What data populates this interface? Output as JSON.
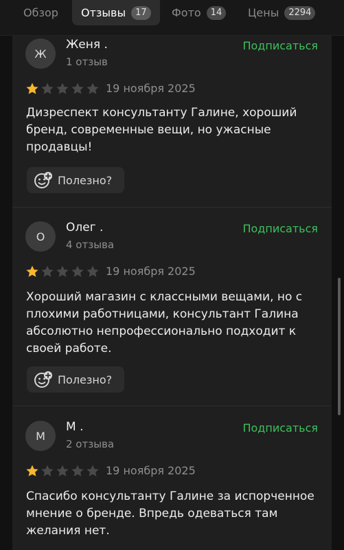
{
  "tabs": [
    {
      "label": "Обзор",
      "count": null
    },
    {
      "label": "Отзывы",
      "count": "17",
      "active": true
    },
    {
      "label": "Фото",
      "count": "14"
    },
    {
      "label": "Цены",
      "count": "2294"
    }
  ],
  "subscribe_label": "Подписаться",
  "useful_label": "Полезно?",
  "colors": {
    "accent": "#3cc15d",
    "star_filled": "#f5b82e",
    "star_empty": "#4a4a4a"
  },
  "reviews": [
    {
      "initial": "Ж",
      "author": "Женя .",
      "review_count": "1 отзыв",
      "rating": 1,
      "date": "19 ноября 2025",
      "text": "Дизреспект консультанту Галине, хороший бренд, современные вещи, но ужасные продавцы!"
    },
    {
      "initial": "О",
      "author": "Олег .",
      "review_count": "4 отзыва",
      "rating": 1,
      "date": "19 ноября 2025",
      "text": "Хороший магазин с классными вещами, но с плохими работницами, консультант Галина абсолютно непрофессионально подходит к своей работе."
    },
    {
      "initial": "М",
      "author": "М .",
      "review_count": "2 отзыва",
      "rating": 1,
      "date": "19 ноября 2025",
      "text": "Спасибо консультанту Галине за испорченное мнение о бренде. Впредь одеваться там желания нет."
    }
  ]
}
